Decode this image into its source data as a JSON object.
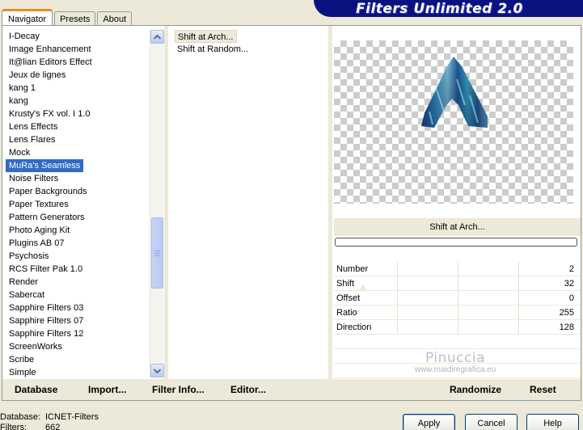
{
  "tabs": [
    {
      "label": "Navigator",
      "active": true
    },
    {
      "label": "Presets",
      "active": false
    },
    {
      "label": "About",
      "active": false
    }
  ],
  "banner": {
    "title": "Filters Unlimited 2.0"
  },
  "categories": [
    "I-Decay",
    "Image Enhancement",
    "It@lian Editors Effect",
    "Jeux de lignes",
    "kang 1",
    "kang",
    "Krusty's FX vol. I 1.0",
    "Lens Effects",
    "Lens Flares",
    "Mock",
    "MuRa's Seamless",
    "Noise Filters",
    "Paper Backgrounds",
    "Paper Textures",
    "Pattern Generators",
    "Photo Aging Kit",
    "Plugins AB 07",
    "Psychosis",
    "RCS Filter Pak 1.0",
    "Render",
    "Sabercat",
    "Sapphire Filters 03",
    "Sapphire Filters 07",
    "Sapphire Filters 12",
    "ScreenWorks",
    "Scribe",
    "Simple"
  ],
  "selected_category": "MuRa's Seamless",
  "filters": [
    "Shift at Arch...",
    "Shift at Random..."
  ],
  "current_filter": "Shift at Arch...",
  "filter_name_display": "Shift at Arch...",
  "params": [
    {
      "name": "Number",
      "value": "2"
    },
    {
      "name": "Shift",
      "value": "32"
    },
    {
      "name": "Offset",
      "value": "0"
    },
    {
      "name": "Ratio",
      "value": "255"
    },
    {
      "name": "Direction",
      "value": "128"
    }
  ],
  "watermark": {
    "name": "Pinuccia",
    "url": "www.maidiregrafica.eu"
  },
  "toolbar": {
    "database": "Database",
    "import": "Import...",
    "filter_info": "Filter Info...",
    "editor": "Editor...",
    "randomize": "Randomize",
    "reset": "Reset"
  },
  "status": {
    "database_label": "Database:",
    "database_value": "ICNET-Filters",
    "filters_label": "Filters:",
    "filters_value": "662"
  },
  "buttons": {
    "apply": "Apply",
    "cancel": "Cancel",
    "help": "Help"
  },
  "colors": {
    "selection": "#316ac5",
    "banner": "#0a1280",
    "tab_highlight": "#e68b2c"
  }
}
